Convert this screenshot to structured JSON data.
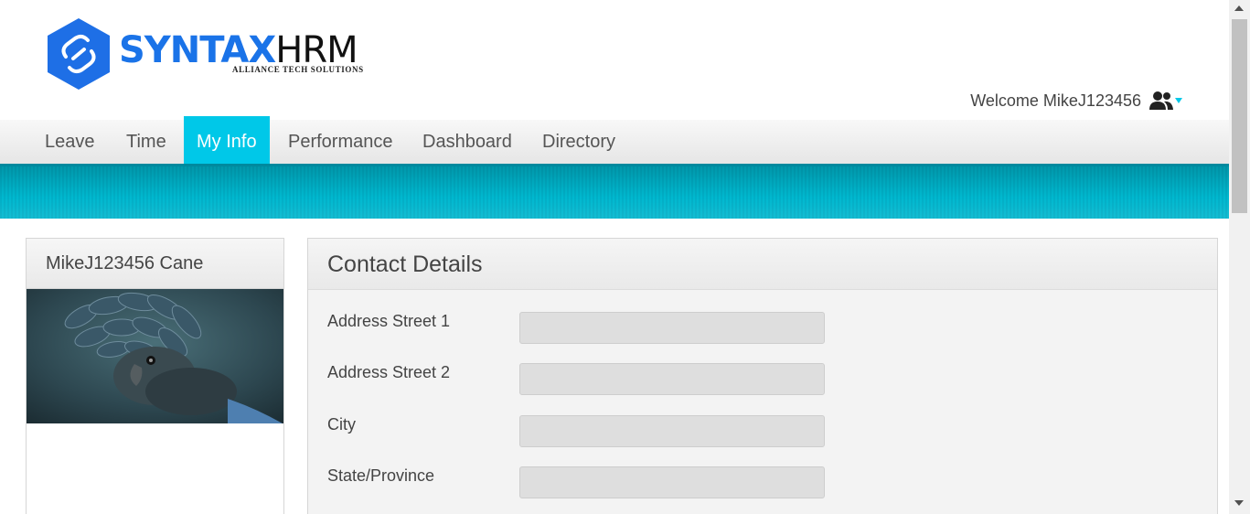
{
  "brand": {
    "name_part1": "SYNTAX",
    "name_part2": "HRM",
    "tagline": "ALLIANCE TECH SOLUTIONS",
    "logo_icon": "hexagon-link-logo",
    "brand_color": "#1a73e8",
    "hex_color": "#1e6fe6"
  },
  "header": {
    "welcome_text": "Welcome MikeJ123456",
    "user_icon": "users-icon",
    "caret_icon": "caret-down-icon"
  },
  "nav": {
    "items": [
      {
        "label": "Leave"
      },
      {
        "label": "Time"
      },
      {
        "label": "My Info",
        "active": true
      },
      {
        "label": "Performance"
      },
      {
        "label": "Dashboard"
      },
      {
        "label": "Directory"
      }
    ],
    "active_color": "#00c8e8",
    "band_color": "#00b2ca"
  },
  "profile": {
    "name": "MikeJ123456 Cane",
    "photo": "black-cockatoo-photo"
  },
  "contact": {
    "title": "Contact Details",
    "fields": [
      {
        "label": "Address Street 1",
        "value": ""
      },
      {
        "label": "Address Street 2",
        "value": ""
      },
      {
        "label": "City",
        "value": ""
      },
      {
        "label": "State/Province",
        "value": ""
      }
    ]
  }
}
